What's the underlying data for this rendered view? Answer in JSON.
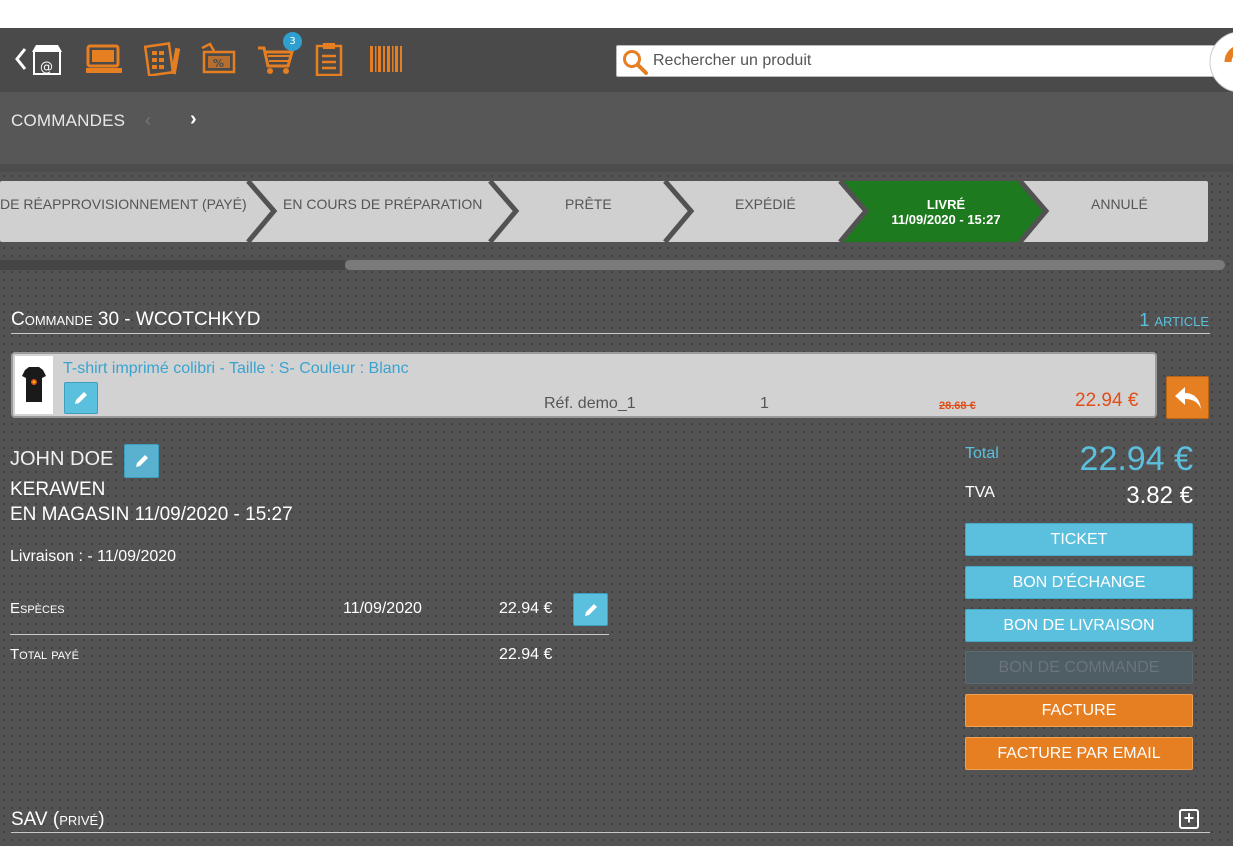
{
  "toolbar": {
    "icons": [
      "back-store-icon",
      "pos-terminal-icon",
      "calculator-icon",
      "discount-ticket-icon",
      "cart-icon",
      "clipboard-icon",
      "barcode-icon"
    ],
    "cart_badge": "3",
    "search_placeholder": "Rechercher un produit"
  },
  "header": {
    "title": "COMMANDES",
    "prev": "‹",
    "next": "›"
  },
  "steps": [
    {
      "label": "DE RÉAPPROVISIONNEMENT (PAYÉ)"
    },
    {
      "label": "EN COURS DE PRÉPARATION"
    },
    {
      "label": "PRÊTE"
    },
    {
      "label": "EXPÉDIÉ"
    },
    {
      "label": "LIVRÉ",
      "date": "11/09/2020 - 15:27",
      "active": true
    },
    {
      "label": "ANNULÉ"
    }
  ],
  "order": {
    "title": "Commande 30 - WCOTCHKYD",
    "articles": "1 article",
    "item": {
      "name": "T-shirt imprimé colibri - Taille : S- Couleur : Blanc",
      "ref": "Réf. demo_1",
      "qty": "1",
      "old_price": "28.68 €",
      "price": "22.94 €"
    },
    "customer": "JOHN DOE",
    "shop": "KERAWEN",
    "shop_date": "EN MAGASIN 11/09/2020 - 15:27",
    "delivery": "Livraison : - 11/09/2020",
    "payments": [
      {
        "label": "Espèces",
        "date": "11/09/2020",
        "amount": "22.94 €"
      }
    ],
    "total_paid_label": "Total payé",
    "total_paid": "22.94 €"
  },
  "totals": {
    "total_label": "Total",
    "total": "22.94 €",
    "tva_label": "TVA",
    "tva": "3.82 €"
  },
  "buttons": {
    "ticket": "TICKET",
    "exchange": "BON D'ÉCHANGE",
    "delivery_note": "BON DE LIVRAISON",
    "order_form": "BON DE COMMANDE",
    "invoice": "FACTURE",
    "invoice_email": "FACTURE PAR EMAIL"
  },
  "sav": {
    "title": "SAV (privé)",
    "add": "+"
  },
  "colors": {
    "accent_blue": "#5bc0de",
    "accent_orange": "#e67e22",
    "active_step": "#1e7a1e",
    "price_red": "#e04e1a"
  }
}
